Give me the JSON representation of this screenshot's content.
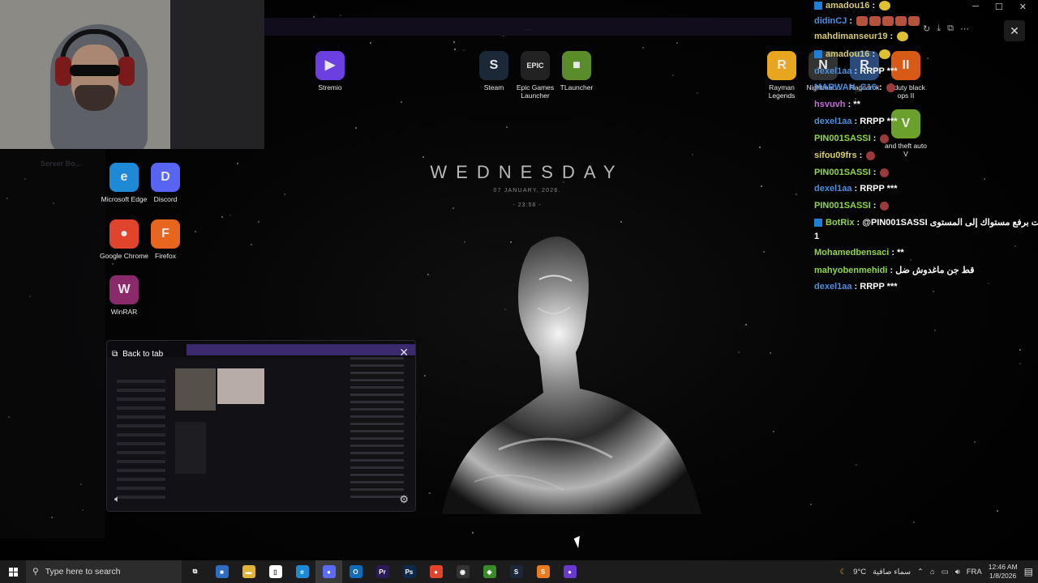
{
  "browser": {
    "notice": "...",
    "bg_label": "Server Bo..."
  },
  "desktop_icons": [
    {
      "id": "stremio",
      "label": "Stremio",
      "color": "#6b3fe0",
      "glyph": "▶"
    },
    {
      "id": "steam",
      "label": "Steam",
      "color": "#1b2838",
      "glyph": "S"
    },
    {
      "id": "epic",
      "label": "Epic Games Launcher",
      "color": "#222222",
      "glyph": "EPIC"
    },
    {
      "id": "tlauncher",
      "label": "TLauncher",
      "color": "#5b8c2a",
      "glyph": "■"
    },
    {
      "id": "rayman",
      "label": "Rayman Legends",
      "color": "#e8a520",
      "glyph": "R"
    },
    {
      "id": "nightmare",
      "label": "Nightmar...",
      "color": "#333333",
      "glyph": "N"
    },
    {
      "id": "ragnarok",
      "label": "Ragnarok",
      "color": "#2a4a7a",
      "glyph": "R"
    },
    {
      "id": "cod",
      "label": "of duty black ops II",
      "color": "#d75a16",
      "glyph": "II"
    },
    {
      "id": "gta",
      "label": "and theft auto V",
      "color": "#6ca02d",
      "glyph": "V"
    },
    {
      "id": "edge",
      "label": "Microsoft Edge",
      "color": "#1e8ad6",
      "glyph": "e"
    },
    {
      "id": "discord",
      "label": "Discord",
      "color": "#5865f2",
      "glyph": "D"
    },
    {
      "id": "chrome",
      "label": "Google Chrome",
      "color": "#e0442c",
      "glyph": "●"
    },
    {
      "id": "firefox",
      "label": "Firefox",
      "color": "#e8651f",
      "glyph": "F"
    },
    {
      "id": "winrar",
      "label": "WinRAR",
      "color": "#8a2a6a",
      "glyph": "W"
    }
  ],
  "wallpaper": {
    "title": "WEDNESDAY",
    "date": "07 JANUARY, 2026.",
    "time": "- 23:58 -"
  },
  "chat": [
    {
      "user": "amadou16",
      "text": "",
      "color": "gold",
      "emotes": 1,
      "badge": true
    },
    {
      "user": "didinCJ",
      "text": "",
      "color": "blue",
      "emotes": 5
    },
    {
      "user": "mahdimanseur19",
      "text": "",
      "color": "gold",
      "emotes": 1
    },
    {
      "user": "amadou16",
      "text": "",
      "color": "gold",
      "emotes": 1,
      "badge": true
    },
    {
      "user": "dexel1aa",
      "text": "RRPP ***",
      "color": "blue",
      "emotes": 0
    },
    {
      "user": "MARWAN_C16",
      "text": "",
      "color": "blue",
      "emotes": 1
    },
    {
      "user": "hsvuvh",
      "text": "**",
      "color": "purple",
      "emotes": 0
    },
    {
      "user": "dexel1aa",
      "text": "RRPP ***",
      "color": "blue",
      "emotes": 0
    },
    {
      "user": "PIN001SASSI",
      "text": "",
      "color": "green",
      "emotes": 1
    },
    {
      "user": "sifou09frs",
      "text": "",
      "color": "red",
      "emotes": 1
    },
    {
      "user": "PIN001SASSI",
      "text": "",
      "color": "green",
      "emotes": 1
    },
    {
      "user": "dexel1aa",
      "text": "RRPP ***",
      "color": "blue",
      "emotes": 0
    },
    {
      "user": "PIN001SASSI",
      "text": "",
      "color": "green",
      "emotes": 1
    },
    {
      "user": "BotRix",
      "text": "@PIN001SASSI قمت برفع مستواك إلى المستوى",
      "color": "green",
      "emotes": 0,
      "badge": true
    },
    {
      "user": "",
      "text": "1",
      "color": "green",
      "emotes": 0
    },
    {
      "user": "Mohamedbensaci",
      "text": "**",
      "color": "green",
      "emotes": 0
    },
    {
      "user": "mahyobenmehidi",
      "text": "قط جن ماغدوش ضل",
      "color": "green",
      "emotes": 0
    },
    {
      "user": "dexel1aa",
      "text": "RRPP ***",
      "color": "blue",
      "emotes": 0
    }
  ],
  "mini_player": {
    "back_to_tab": "Back to tab"
  },
  "taskbar": {
    "search_placeholder": "Type here to search",
    "apps": [
      {
        "id": "task-view",
        "glyph": "⧉",
        "color": "#1c1c1c"
      },
      {
        "id": "store",
        "glyph": "■",
        "color": "#2d6cc0"
      },
      {
        "id": "file-explorer",
        "glyph": "▬",
        "color": "#e2b339"
      },
      {
        "id": "notepad",
        "glyph": "▯",
        "color": "#ffffff"
      },
      {
        "id": "edge",
        "glyph": "e",
        "color": "#1e8ad6"
      },
      {
        "id": "browser-active",
        "glyph": "●",
        "color": "#5a6cf2"
      },
      {
        "id": "outlook",
        "glyph": "O",
        "color": "#0f6cbd"
      },
      {
        "id": "premiere",
        "glyph": "Pr",
        "color": "#2a1a5a"
      },
      {
        "id": "photoshop",
        "glyph": "Ps",
        "color": "#0c2a4a"
      },
      {
        "id": "chrome",
        "glyph": "●",
        "color": "#e0442c"
      },
      {
        "id": "obs",
        "glyph": "◉",
        "color": "#333333"
      },
      {
        "id": "app-green",
        "glyph": "◆",
        "color": "#3a8a2a"
      },
      {
        "id": "steam",
        "glyph": "S",
        "color": "#1b2838"
      },
      {
        "id": "sublime",
        "glyph": "S",
        "color": "#e87b1f"
      },
      {
        "id": "app-purple",
        "glyph": "●",
        "color": "#6a3ad0"
      }
    ],
    "weather_temp": "9°C",
    "weather_text": "سماء صافية",
    "language": "FRA",
    "time": "12:46 AM",
    "date": "1/8/2026"
  }
}
